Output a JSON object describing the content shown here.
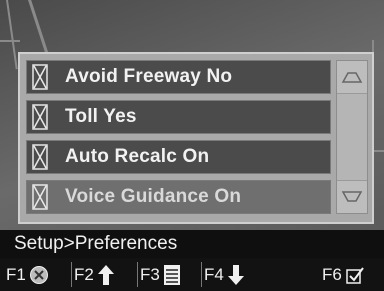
{
  "menu": {
    "items": [
      {
        "label": "Avoid Freeway No",
        "icon": "x-checkbox-icon"
      },
      {
        "label": "Toll Yes",
        "icon": "x-checkbox-icon"
      },
      {
        "label": "Auto Recalc On",
        "icon": "x-checkbox-icon"
      },
      {
        "label": "Voice Guidance On",
        "icon": "x-checkbox-icon",
        "dimmed": true
      }
    ],
    "scroll_up_icon": "scroll-up-icon",
    "scroll_down_icon": "scroll-down-icon"
  },
  "status": {
    "breadcrumb": "Setup>Preferences"
  },
  "function_keys": [
    {
      "key": "F1",
      "icon": "cancel-icon"
    },
    {
      "key": "F2",
      "icon": "up-arrow-icon"
    },
    {
      "key": "F3",
      "icon": "list-icon"
    },
    {
      "key": "F4",
      "icon": "down-arrow-icon"
    },
    {
      "key": "F6",
      "icon": "checkmark-icon"
    }
  ],
  "colors": {
    "panel": "#a9a9a9",
    "row": "#4b4b4b",
    "row_dimmed": "#6f6f6f",
    "bar": "#0f0f0f"
  }
}
